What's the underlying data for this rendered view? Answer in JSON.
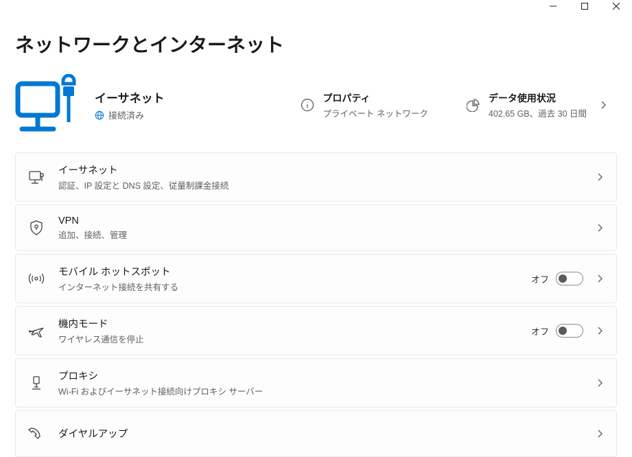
{
  "page_title": "ネットワークとインターネット",
  "connection": {
    "name": "イーサネット",
    "status": "接続済み"
  },
  "properties": {
    "title": "プロパティ",
    "subtitle": "プライベート ネットワーク"
  },
  "data_usage": {
    "title": "データ使用状況",
    "subtitle": "402.65 GB、過去 30 日間"
  },
  "items": [
    {
      "title": "イーサネット",
      "subtitle": "認証、IP 設定と DNS 設定、従量制課金接続",
      "icon": "monitor-icon"
    },
    {
      "title": "VPN",
      "subtitle": "追加、接続、管理",
      "icon": "shield-icon"
    },
    {
      "title": "モバイル ホットスポット",
      "subtitle": "インターネット接続を共有する",
      "icon": "hotspot-icon",
      "toggle": "オフ"
    },
    {
      "title": "機内モード",
      "subtitle": "ワイヤレス通信を停止",
      "icon": "airplane-icon",
      "toggle": "オフ"
    },
    {
      "title": "プロキシ",
      "subtitle": "Wi-Fi およびイーサネット接続向けプロキシ サーバー",
      "icon": "proxy-icon"
    },
    {
      "title": "ダイヤルアップ",
      "subtitle": "",
      "icon": "dialup-icon"
    }
  ]
}
